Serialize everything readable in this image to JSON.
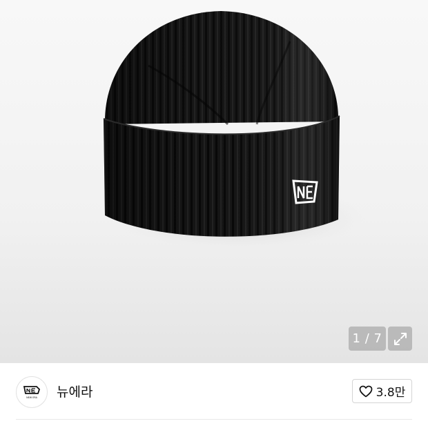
{
  "gallery": {
    "current_page": "1",
    "total_pages": "7",
    "page_separator": " / ",
    "expand_icon": "expand-arrows-icon",
    "image_subject": "black ribbed knit cuff beanie with logo patch"
  },
  "brand": {
    "name": "뉴에라",
    "logo_text": "NEW ERA",
    "logo_icon": "new-era-flag-logo"
  },
  "like": {
    "icon": "heart-outline-icon",
    "count": "3.8만"
  },
  "colors": {
    "background_top": "#f8f8f8",
    "product": "#141414",
    "logo_patch": "#ffffff",
    "overlay_button": "#969696",
    "text": "#111111",
    "border": "#d4d4d4"
  }
}
